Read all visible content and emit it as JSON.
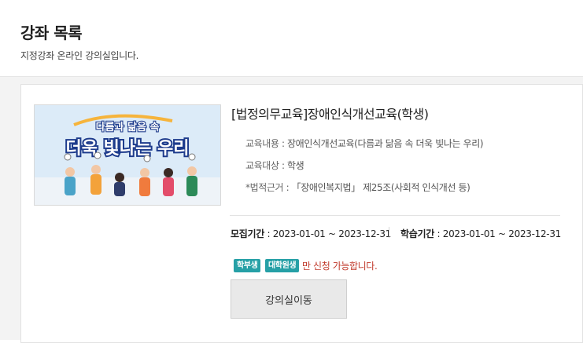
{
  "page": {
    "title": "강좌 목록",
    "description": "지정강좌 온라인 강의실입니다."
  },
  "course": {
    "thumbnail": {
      "headline_top": "다름과 닮음 속",
      "headline_main": "더욱 빛나는 우리"
    },
    "title": "[법정의무교육]장애인식개선교육(학생)",
    "info": [
      {
        "label": "교육내용",
        "value": "장애인식개선교육(다름과 닮음 속 더욱 빛나는 우리)"
      },
      {
        "label": "교육대상",
        "value": "학생"
      },
      {
        "label": "*법적근거",
        "value": "「장애인복지법」 제25조(사회적 인식개선 등)"
      }
    ],
    "separator": " : ",
    "recruit_period": {
      "label": "모집기간",
      "value": "2023-01-01 ~ 2023-12-31"
    },
    "study_period": {
      "label": "학습기간",
      "value": "2023-01-01 ~ 2023-12-31"
    },
    "badges": [
      "학부생",
      "대학원생"
    ],
    "eligibility_notice": "만 신청 가능합니다.",
    "enter_button_label": "강의실이동"
  },
  "colors": {
    "badge": "#26a0a6",
    "notice": "#c0392b",
    "button_bg": "#e9e9e9",
    "content_bg": "#f3f3f3"
  }
}
